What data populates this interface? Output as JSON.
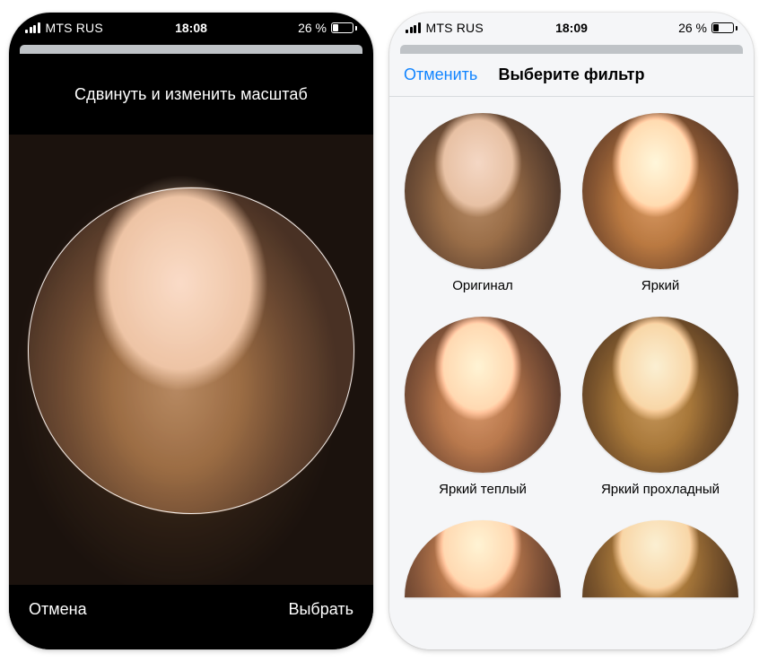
{
  "status_left": {
    "carrier": "MTS RUS",
    "signal_icon": "signal-icon",
    "time": "18:08",
    "battery_pct": "26 %",
    "battery_icon": "battery-icon"
  },
  "status_right": {
    "carrier": "MTS RUS",
    "signal_icon": "signal-icon",
    "time": "18:09",
    "battery_pct": "26 %",
    "battery_icon": "battery-icon"
  },
  "crop": {
    "instruction": "Сдвинуть и изменить масштаб",
    "cancel_label": "Отмена",
    "choose_label": "Выбрать"
  },
  "filters": {
    "cancel_label": "Отменить",
    "title": "Выберите фильтр",
    "items": [
      {
        "label": "Оригинал"
      },
      {
        "label": "Яркий"
      },
      {
        "label": "Яркий теплый"
      },
      {
        "label": "Яркий прохладный"
      }
    ]
  },
  "colors": {
    "ios_blue": "#1184ff",
    "filters_bg": "#f5f6f8"
  }
}
